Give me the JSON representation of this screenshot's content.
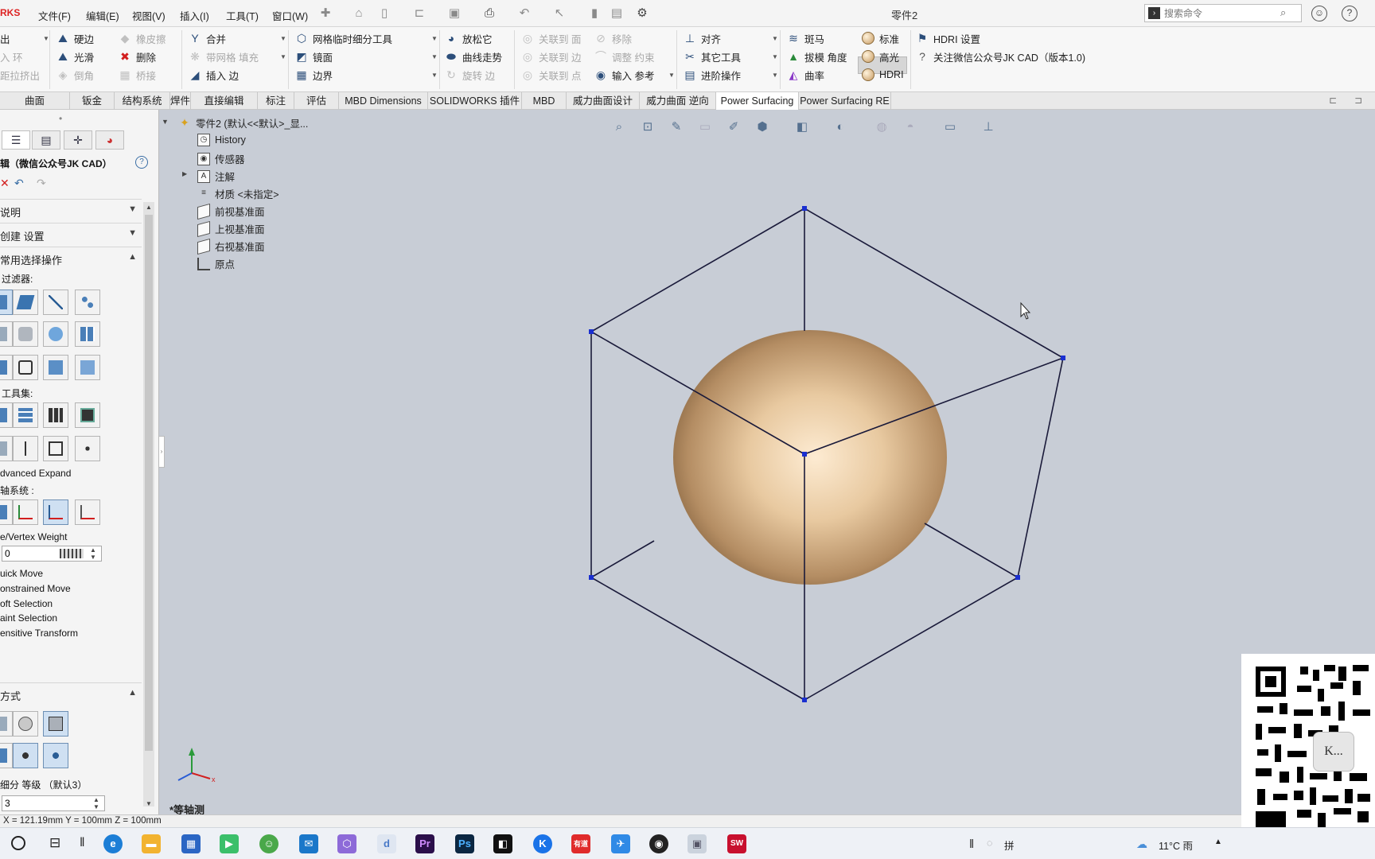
{
  "app": {
    "logo": "RKS",
    "doc_title": "零件2"
  },
  "menu": [
    "文件(F)",
    "编辑(E)",
    "视图(V)",
    "插入(I)",
    "工具(T)",
    "窗口(W)"
  ],
  "search": {
    "placeholder": "搜索命令"
  },
  "ribbon": {
    "col0": [
      "出",
      "入 环",
      "距拉挤出"
    ],
    "col1": [
      "硬边",
      "光滑",
      "倒角"
    ],
    "col2": [
      "橡皮擦",
      "删除",
      "桥接"
    ],
    "col3": [
      "合并",
      "带网格 填充",
      "插入 边"
    ],
    "col4": [
      "网格临时细分工具",
      "镜面",
      "边界"
    ],
    "col5": [
      "放松它",
      "曲线走势",
      "旋转 边"
    ],
    "col6": [
      "关联到 面",
      "关联到 边",
      "关联到 点"
    ],
    "col7": [
      "移除",
      "调整 约束",
      "输入 参考"
    ],
    "col8": [
      "对齐",
      "其它工具",
      "进阶操作"
    ],
    "col9": [
      "斑马",
      "拔模 角度",
      "曲率"
    ],
    "col10": [
      "标准",
      "高光",
      "HDRI"
    ],
    "col11": [
      "HDRI 设置",
      "关注微信公众号JK CAD（版本1.0)"
    ]
  },
  "tabs": [
    "曲面",
    "钣金",
    "结构系统",
    "焊件",
    "直接编辑",
    "标注",
    "评估",
    "MBD Dimensions",
    "SOLIDWORKS 插件",
    "MBD",
    "威力曲面设计",
    "威力曲面 逆向",
    "Power Surfacing",
    "Power Surfacing RE"
  ],
  "panel": {
    "title": "辑（微信公众号JK CAD）",
    "help": "?",
    "sec_desc": "说明",
    "sec_create": "创建 设置",
    "sec_common": "常用选择操作",
    "filter_label": "过滤器:",
    "toolset_label": "工具集:",
    "advanced_expand": "dvanced Expand",
    "axis_label": "轴系统 :",
    "vertex_weight": "e/Vertex Weight",
    "weight_value": "0",
    "options": [
      "uick Move",
      "onstrained Move",
      "oft Selection",
      "aint Selection",
      "ensitive Transform"
    ],
    "sec_mode": "方式",
    "subdiv_label": "细分 等级 （默认3）",
    "subdiv_value": "3"
  },
  "tree": {
    "root": "零件2 (默认<<默认>_显...",
    "items": [
      "History",
      "传感器",
      "注解",
      "材质 <未指定>",
      "前视基准面",
      "上视基准面",
      "右视基准面",
      "原点"
    ]
  },
  "viewport": {
    "view_label": "*等轴测",
    "sphere_color": "#e8c9a0",
    "cage_color": "#1a1a3a",
    "background": "#c9ced8"
  },
  "status": {
    "coords": "X = 121.19mm Y = 100mm Z = 100mm"
  },
  "taskbar": {
    "temp": "11°C 雨",
    "ime": "拼"
  },
  "qr": {
    "badge": "K..."
  }
}
